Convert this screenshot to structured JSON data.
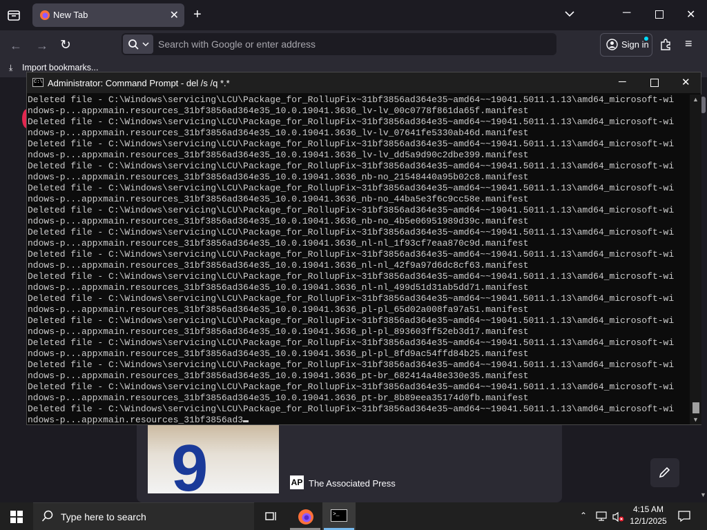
{
  "browser": {
    "tab_title": "New Tab",
    "url_placeholder": "Search with Google or enter address",
    "signin_label": "Sign in",
    "import_bookmarks": "Import bookmarks..."
  },
  "news_card": {
    "source": "The Associated Press",
    "source_logo": "AP",
    "jersey_number": "9"
  },
  "cmd": {
    "title": "Administrator: Command Prompt - del  /s /q *.*",
    "lines": [
      "Deleted file - C:\\Windows\\servicing\\LCU\\Package_for_RollupFix~31bf3856ad364e35~amd64~~19041.5011.1.13\\amd64_microsoft-wi",
      "ndows-p...appxmain.resources_31bf3856ad364e35_10.0.19041.3636_lv-lv_00c0778f861da65f.manifest",
      "Deleted file - C:\\Windows\\servicing\\LCU\\Package_for_RollupFix~31bf3856ad364e35~amd64~~19041.5011.1.13\\amd64_microsoft-wi",
      "ndows-p...appxmain.resources_31bf3856ad364e35_10.0.19041.3636_lv-lv_07641fe5330ab46d.manifest",
      "Deleted file - C:\\Windows\\servicing\\LCU\\Package_for_RollupFix~31bf3856ad364e35~amd64~~19041.5011.1.13\\amd64_microsoft-wi",
      "ndows-p...appxmain.resources_31bf3856ad364e35_10.0.19041.3636_lv-lv_dd5a9d90c2dbe399.manifest",
      "Deleted file - C:\\Windows\\servicing\\LCU\\Package_for_RollupFix~31bf3856ad364e35~amd64~~19041.5011.1.13\\amd64_microsoft-wi",
      "ndows-p...appxmain.resources_31bf3856ad364e35_10.0.19041.3636_nb-no_21548440a95b02c8.manifest",
      "Deleted file - C:\\Windows\\servicing\\LCU\\Package_for_RollupFix~31bf3856ad364e35~amd64~~19041.5011.1.13\\amd64_microsoft-wi",
      "ndows-p...appxmain.resources_31bf3856ad364e35_10.0.19041.3636_nb-no_44ba5e3f6c9cc58e.manifest",
      "Deleted file - C:\\Windows\\servicing\\LCU\\Package_for_RollupFix~31bf3856ad364e35~amd64~~19041.5011.1.13\\amd64_microsoft-wi",
      "ndows-p...appxmain.resources_31bf3856ad364e35_10.0.19041.3636_nb-no_4b5e06951989d39c.manifest",
      "Deleted file - C:\\Windows\\servicing\\LCU\\Package_for_RollupFix~31bf3856ad364e35~amd64~~19041.5011.1.13\\amd64_microsoft-wi",
      "ndows-p...appxmain.resources_31bf3856ad364e35_10.0.19041.3636_nl-nl_1f93cf7eaa870c9d.manifest",
      "Deleted file - C:\\Windows\\servicing\\LCU\\Package_for_RollupFix~31bf3856ad364e35~amd64~~19041.5011.1.13\\amd64_microsoft-wi",
      "ndows-p...appxmain.resources_31bf3856ad364e35_10.0.19041.3636_nl-nl_42f9a97d6dc8cf63.manifest",
      "Deleted file - C:\\Windows\\servicing\\LCU\\Package_for_RollupFix~31bf3856ad364e35~amd64~~19041.5011.1.13\\amd64_microsoft-wi",
      "ndows-p...appxmain.resources_31bf3856ad364e35_10.0.19041.3636_nl-nl_499d51d31ab5dd71.manifest",
      "Deleted file - C:\\Windows\\servicing\\LCU\\Package_for_RollupFix~31bf3856ad364e35~amd64~~19041.5011.1.13\\amd64_microsoft-wi",
      "ndows-p...appxmain.resources_31bf3856ad364e35_10.0.19041.3636_pl-pl_65d02a008fa97a51.manifest",
      "Deleted file - C:\\Windows\\servicing\\LCU\\Package_for_RollupFix~31bf3856ad364e35~amd64~~19041.5011.1.13\\amd64_microsoft-wi",
      "ndows-p...appxmain.resources_31bf3856ad364e35_10.0.19041.3636_pl-pl_893603ff52eb3d17.manifest",
      "Deleted file - C:\\Windows\\servicing\\LCU\\Package_for_RollupFix~31bf3856ad364e35~amd64~~19041.5011.1.13\\amd64_microsoft-wi",
      "ndows-p...appxmain.resources_31bf3856ad364e35_10.0.19041.3636_pl-pl_8fd9ac54ffd84b25.manifest",
      "Deleted file - C:\\Windows\\servicing\\LCU\\Package_for_RollupFix~31bf3856ad364e35~amd64~~19041.5011.1.13\\amd64_microsoft-wi",
      "ndows-p...appxmain.resources_31bf3856ad364e35_10.0.19041.3636_pt-br_682414a48e330e35.manifest",
      "Deleted file - C:\\Windows\\servicing\\LCU\\Package_for_RollupFix~31bf3856ad364e35~amd64~~19041.5011.1.13\\amd64_microsoft-wi",
      "ndows-p...appxmain.resources_31bf3856ad364e35_10.0.19041.3636_pt-br_8b89eea35174d0fb.manifest",
      "Deleted file - C:\\Windows\\servicing\\LCU\\Package_for_RollupFix~31bf3856ad364e35~amd64~~19041.5011.1.13\\amd64_microsoft-wi"
    ],
    "last_line": "ndows-p...appxmain.resources_31bf3856ad3"
  },
  "taskbar": {
    "search_placeholder": "Type here to search",
    "time": "4:15 AM",
    "date": "12/1/2025"
  },
  "colors": {
    "browser_bg": "#1c1b22",
    "toolbar": "#2b2a33",
    "tab_active": "#42414d",
    "cmd_bg": "#0c0c0c",
    "cmd_text": "#cccccc",
    "taskbar": "#202020",
    "accent": "#00ddff"
  }
}
